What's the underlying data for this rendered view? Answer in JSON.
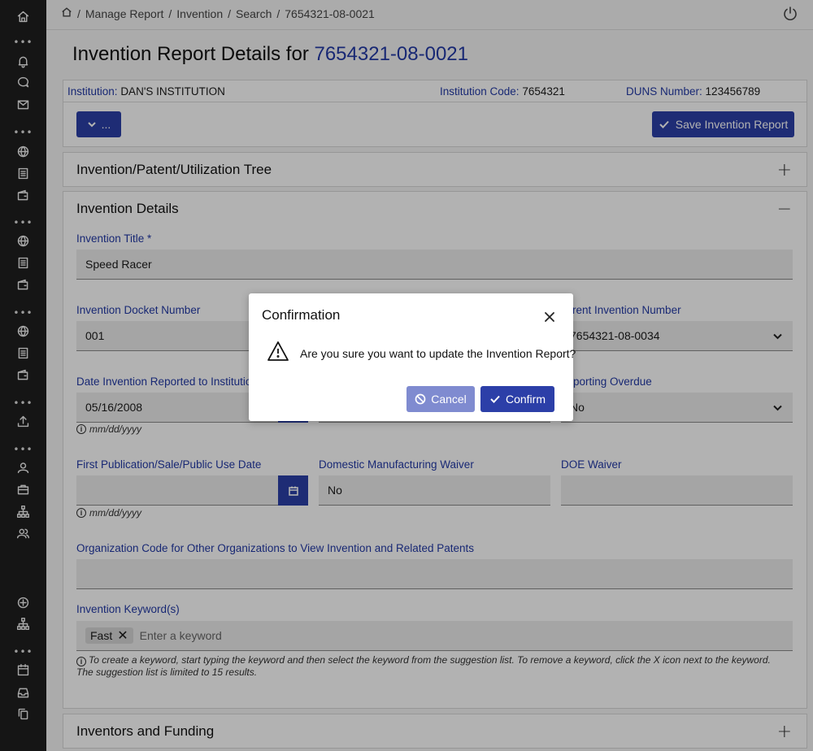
{
  "breadcrumb": {
    "items": [
      "Manage Report",
      "Invention",
      "Search",
      "7654321-08-0021"
    ]
  },
  "page": {
    "title_prefix": "Invention Report Details for",
    "title_id": "7654321-08-0021"
  },
  "institution": {
    "name_label": "Institution:",
    "name_value": "DAN'S INSTITUTION",
    "code_label": "Institution Code:",
    "code_value": "7654321",
    "duns_label": "DUNS Number:",
    "duns_value": "123456789"
  },
  "toolbar": {
    "more_label": "...",
    "save_label": "Save Invention Report"
  },
  "sections": {
    "tree_title": "Invention/Patent/Utilization Tree",
    "tree_toggle": "+",
    "details_title": "Invention Details",
    "details_toggle": "−",
    "inventors_title": "Inventors and Funding",
    "inventors_toggle": "+"
  },
  "form": {
    "title_label": "Invention Title *",
    "title_value": "Speed Racer",
    "docket_label": "Invention Docket Number",
    "docket_value": "001",
    "parent_label": "rent Invention Number",
    "parent_value": "7654321-08-0034",
    "date_reported_label": "Date Invention Reported to Institutio",
    "date_reported_value": "05/16/2008",
    "date_hint": "mm/dd/yyyy",
    "overdue_label": "porting Overdue",
    "overdue_value": "No",
    "first_pub_label": "First Publication/Sale/Public Use Date",
    "first_pub_value": "",
    "first_pub_hint": "mm/dd/yyyy",
    "dmw_label": "Domestic Manufacturing Waiver",
    "dmw_value": "No",
    "doe_label": "DOE Waiver",
    "doe_value": "",
    "org_code_label": "Organization Code for Other Organizations to View Invention and Related Patents",
    "org_code_value": "",
    "keywords_label": "Invention Keyword(s)",
    "keyword_chip": "Fast",
    "keyword_placeholder": "Enter a keyword",
    "keywords_hint": "To create a keyword, start typing the keyword and then select the keyword from the suggestion list. To remove a keyword, click the X icon next to the keyword. The suggestion list is limited to 15 results."
  },
  "modal": {
    "title": "Confirmation",
    "message": "Are you sure you want to update the Invention Report?",
    "cancel_label": "Cancel",
    "confirm_label": "Confirm"
  },
  "colors": {
    "primary": "#2c3fa8",
    "label_blue": "#233aa6",
    "rail": "#1f1f1f"
  },
  "icons": {
    "rail": [
      "home-icon",
      "bell-icon",
      "chat-icon",
      "mail-icon",
      "globe-icon",
      "document-icon",
      "wallet-icon",
      "upload-icon",
      "user-icon",
      "briefcase-icon",
      "org-chart-icon",
      "users-icon",
      "plus-circle-icon",
      "calendar-icon",
      "inbox-icon",
      "copy-icon"
    ]
  }
}
